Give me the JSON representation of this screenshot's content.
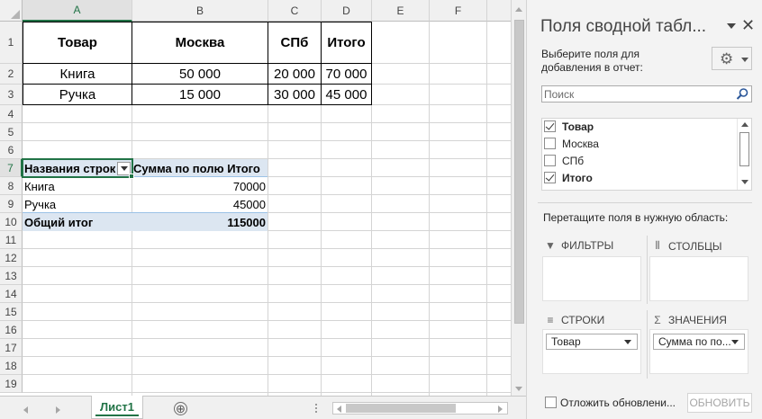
{
  "sheet": {
    "columns": [
      "A",
      "B",
      "C",
      "D",
      "E",
      "F"
    ],
    "rows": [
      "1",
      "2",
      "3",
      "4",
      "5",
      "6",
      "7",
      "8",
      "9",
      "10",
      "11",
      "12",
      "13",
      "14",
      "15",
      "16",
      "17",
      "18",
      "19"
    ],
    "source_table": {
      "headers": [
        "Товар",
        "Москва",
        "СПб",
        "Итого"
      ],
      "rows": [
        [
          "Книга",
          "50 000",
          "20 000",
          "70 000"
        ],
        [
          "Ручка",
          "15 000",
          "30 000",
          "45 000"
        ]
      ]
    },
    "pivot": {
      "row_header": "Названия строк",
      "value_header": "Сумма по полю Итого",
      "rows": [
        {
          "label": "Книга",
          "value": "70000"
        },
        {
          "label": "Ручка",
          "value": "45000"
        }
      ],
      "total": {
        "label": "Общий итог",
        "value": "115000"
      }
    },
    "tab_label": "Лист1",
    "add_sheet": "⊕",
    "accent_color": "#217346",
    "pivot_band_color": "#dce6f1"
  },
  "pane": {
    "title": "Поля сводной табл...",
    "subtitle": "Выберите поля для добавления в отчет:",
    "close": "✕",
    "gear": "⚙",
    "search_placeholder": "Поиск",
    "fields": [
      {
        "label": "Товар",
        "checked": true
      },
      {
        "label": "Москва",
        "checked": false
      },
      {
        "label": "СПб",
        "checked": false
      },
      {
        "label": "Итого",
        "checked": true
      }
    ],
    "drag_label": "Перетащите поля в нужную область:",
    "areas": {
      "filters": "ФИЛЬТРЫ",
      "columns": "СТОЛБЦЫ",
      "rows": "СТРОКИ",
      "values": "ЗНАЧЕНИЯ",
      "rows_chip": "Товар",
      "values_chip": "Сумма по по..."
    },
    "area_icons": {
      "filters": "filter-icon",
      "columns": "columns-icon",
      "rows": "rows-icon",
      "values": "sigma-icon"
    },
    "defer_label": "Отложить обновлени...",
    "update_button": "ОБНОВИТЬ"
  }
}
